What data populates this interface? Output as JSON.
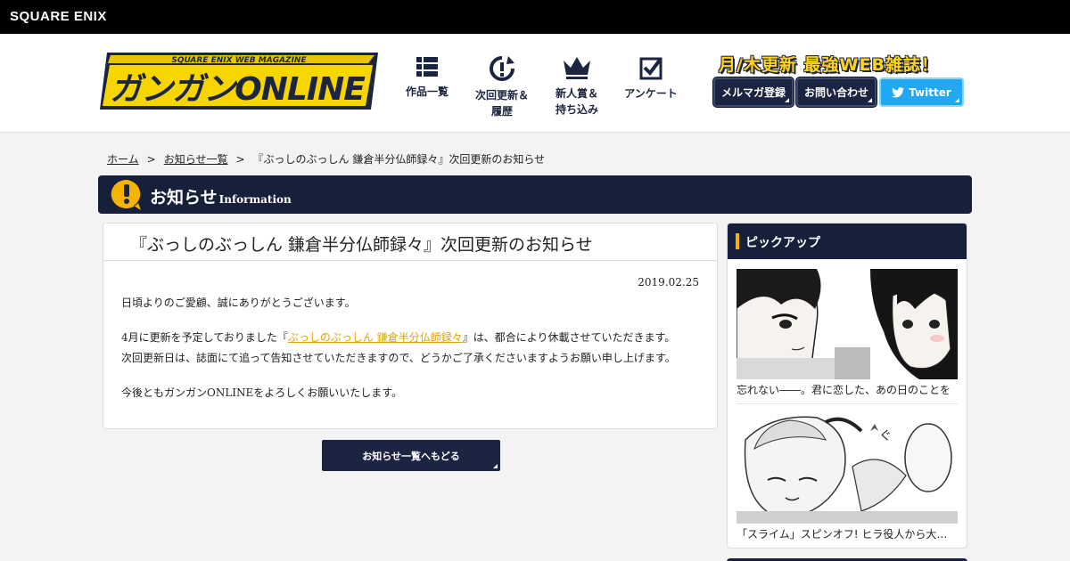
{
  "corp": {
    "logo_text": "SQUARE ENIX"
  },
  "header": {
    "logo_alt": "ガンガンONLINE",
    "logo_top_text": "SQUARE ENIX WEB MAGAZINE",
    "logo_main_text": "ガンガンONLINE",
    "tagline": "月/木更新 最強WEB雑誌！",
    "nav": [
      {
        "line1": "作品一覧",
        "line2": "",
        "icon": "grid-list-icon"
      },
      {
        "line1": "次回更新＆",
        "line2": "履歴",
        "icon": "update-clock-icon"
      },
      {
        "line1": "新人賞＆",
        "line2": "持ち込み",
        "icon": "crown-icon"
      },
      {
        "line1": "アンケート",
        "line2": "",
        "icon": "checkbox-icon"
      }
    ],
    "buttons": {
      "mailmag": "メルマガ登録",
      "contact": "お問い合わせ",
      "twitter": "Twitter"
    }
  },
  "breadcrumb": {
    "home": "ホーム",
    "news_list": "お知らせ一覧",
    "current": "『ぶっしのぶっしん 鎌倉半分仏師録々』次回更新のお知らせ",
    "separator": ">"
  },
  "section": {
    "title": "お知らせ",
    "subtitle": "Information"
  },
  "article": {
    "title": "『ぶっしのぶっしん 鎌倉半分仏師録々』次回更新のお知らせ",
    "date": "2019.02.25",
    "p1": "日頃よりのご愛顧、誠にありがとうございます。",
    "p2_before": "4月に更新を予定しておりました『",
    "p2_link": "ぶっしのぶっしん 鎌倉半分仏師録々",
    "p2_after": "』は、都合により休載させていただきます。",
    "p2_line2": "次回更新日は、誌面にて追って告知させていただきますので、どうかご了承くださいますようお願い申し上げます。",
    "p3": "今後ともガンガンONLINEをよろしくお願いいたします。",
    "back_label": "お知らせ一覧へもどる"
  },
  "sidebar": {
    "title": "ピックアップ",
    "items": [
      {
        "caption": "忘れない――。君に恋した、あの日のことを"
      },
      {
        "caption": "「スライム」スピンオフ! ヒラ役人から大臣…"
      }
    ]
  },
  "colors": {
    "navy": "#17203a",
    "accent": "#f5b400",
    "link": "#e4a100",
    "twitter": "#22a8f0"
  }
}
